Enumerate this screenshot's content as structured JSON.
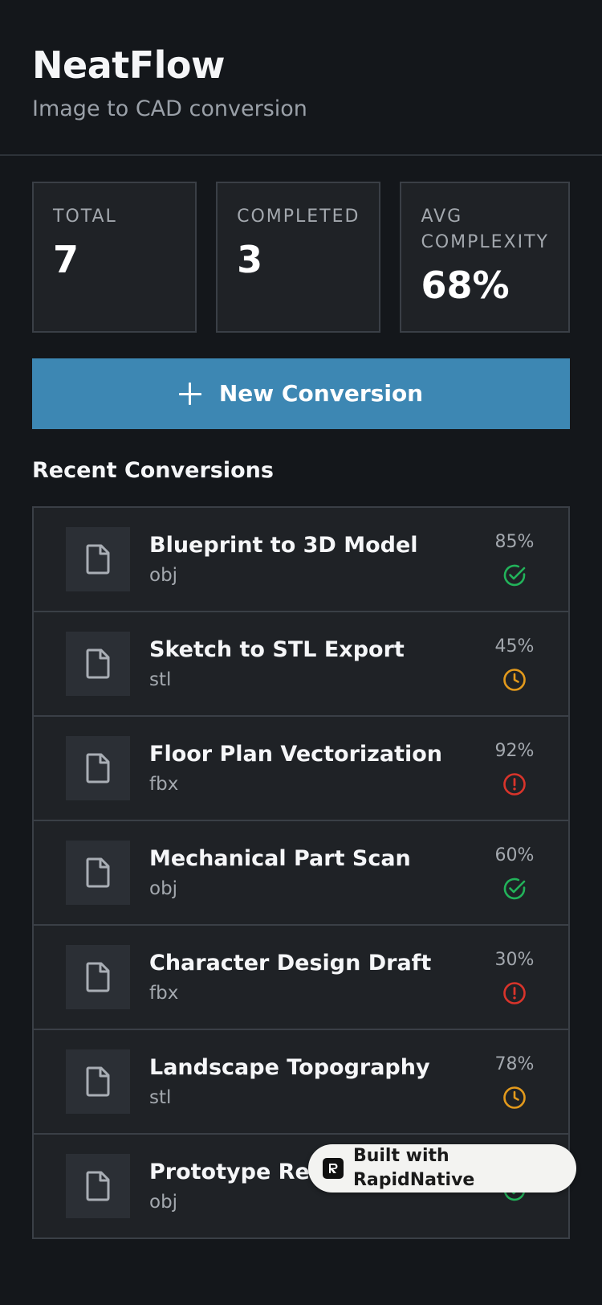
{
  "app": {
    "title": "NeatFlow",
    "subtitle": "Image to CAD conversion"
  },
  "stats": [
    {
      "label": "TOTAL",
      "value": "7"
    },
    {
      "label": "COMPLETED",
      "value": "3"
    },
    {
      "label": "AVG COMPLEXITY",
      "value": "68%"
    }
  ],
  "new_button": {
    "label": "New Conversion",
    "icon": "plus-icon"
  },
  "section": {
    "title": "Recent Conversions"
  },
  "conversions": [
    {
      "name": "Blueprint to 3D Model",
      "format": "obj",
      "progress": "85%",
      "status": "completed",
      "status_icon": "check-circle-icon"
    },
    {
      "name": "Sketch to STL Export",
      "format": "stl",
      "progress": "45%",
      "status": "processing",
      "status_icon": "clock-icon"
    },
    {
      "name": "Floor Plan Vectorization",
      "format": "fbx",
      "progress": "92%",
      "status": "error",
      "status_icon": "alert-circle-icon"
    },
    {
      "name": "Mechanical Part Scan",
      "format": "obj",
      "progress": "60%",
      "status": "completed",
      "status_icon": "check-circle-icon"
    },
    {
      "name": "Character Design Draft",
      "format": "fbx",
      "progress": "30%",
      "status": "error",
      "status_icon": "alert-circle-icon"
    },
    {
      "name": "Landscape Topography",
      "format": "stl",
      "progress": "78%",
      "status": "processing",
      "status_icon": "clock-icon"
    },
    {
      "name": "Prototype Render",
      "format": "obj",
      "progress": "",
      "status": "completed",
      "status_icon": "check-circle-icon"
    }
  ],
  "badge": {
    "label": "Built with RapidNative"
  },
  "colors": {
    "background": "#14171b",
    "card": "#1f2226",
    "border": "#3a3f46",
    "accent": "#3d87b3",
    "completed": "#22b35a",
    "processing": "#e39a1c",
    "error": "#d9342b"
  }
}
